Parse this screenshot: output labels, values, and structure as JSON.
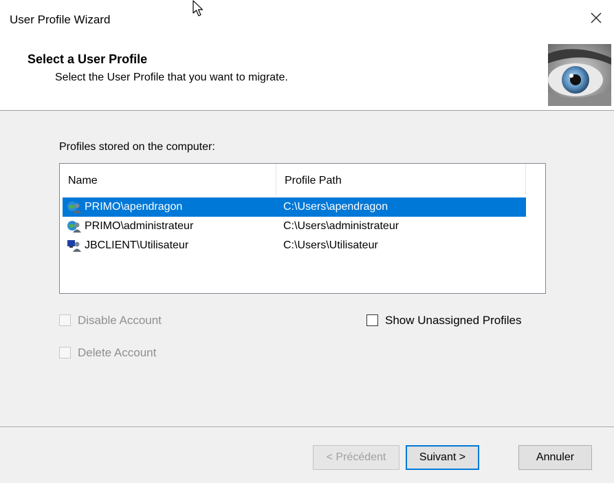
{
  "window": {
    "title": "User Profile Wizard",
    "close_icon": "close-icon"
  },
  "header": {
    "title": "Select a User Profile",
    "subtitle": "Select the User Profile that you want to migrate."
  },
  "profiles": {
    "label": "Profiles stored on the computer:",
    "columns": [
      "Name",
      "Profile Path"
    ],
    "rows": [
      {
        "name": "PRIMO\\apendragon",
        "path": "C:\\Users\\apendragon",
        "icon": "domain-user-icon",
        "selected": true
      },
      {
        "name": "PRIMO\\administrateur",
        "path": "C:\\Users\\administrateur",
        "icon": "domain-user-icon",
        "selected": false
      },
      {
        "name": "JBCLIENT\\Utilisateur",
        "path": "C:\\Users\\Utilisateur",
        "icon": "local-user-icon",
        "selected": false
      }
    ],
    "selection_color": "#0078d7"
  },
  "options": {
    "disable_account": {
      "label": "Disable Account",
      "checked": false,
      "enabled": false
    },
    "delete_account": {
      "label": "Delete Account",
      "checked": false,
      "enabled": false
    },
    "show_unassigned": {
      "label": "Show Unassigned Profiles",
      "checked": false,
      "enabled": true
    }
  },
  "buttons": {
    "back": "< Précédent",
    "next": "Suivant >",
    "cancel": "Annuler"
  }
}
